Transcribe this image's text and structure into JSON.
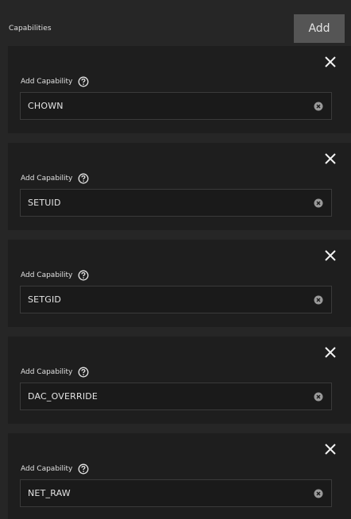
{
  "section": {
    "title": "Capabilities",
    "add_label": "Add"
  },
  "capabilities": [
    {
      "label": "Add Capability",
      "value": "CHOWN"
    },
    {
      "label": "Add Capability",
      "value": "SETUID"
    },
    {
      "label": "Add Capability",
      "value": "SETGID"
    },
    {
      "label": "Add Capability",
      "value": "DAC_OVERRIDE"
    },
    {
      "label": "Add Capability",
      "value": "NET_RAW"
    }
  ],
  "icons": {
    "close": "close-icon",
    "help": "help-circle-icon",
    "clear": "clear-circle-icon"
  },
  "colors": {
    "background": "#262626",
    "card": "#1e1e1e",
    "add_button": "#555555",
    "text": "#e4e4e4"
  }
}
